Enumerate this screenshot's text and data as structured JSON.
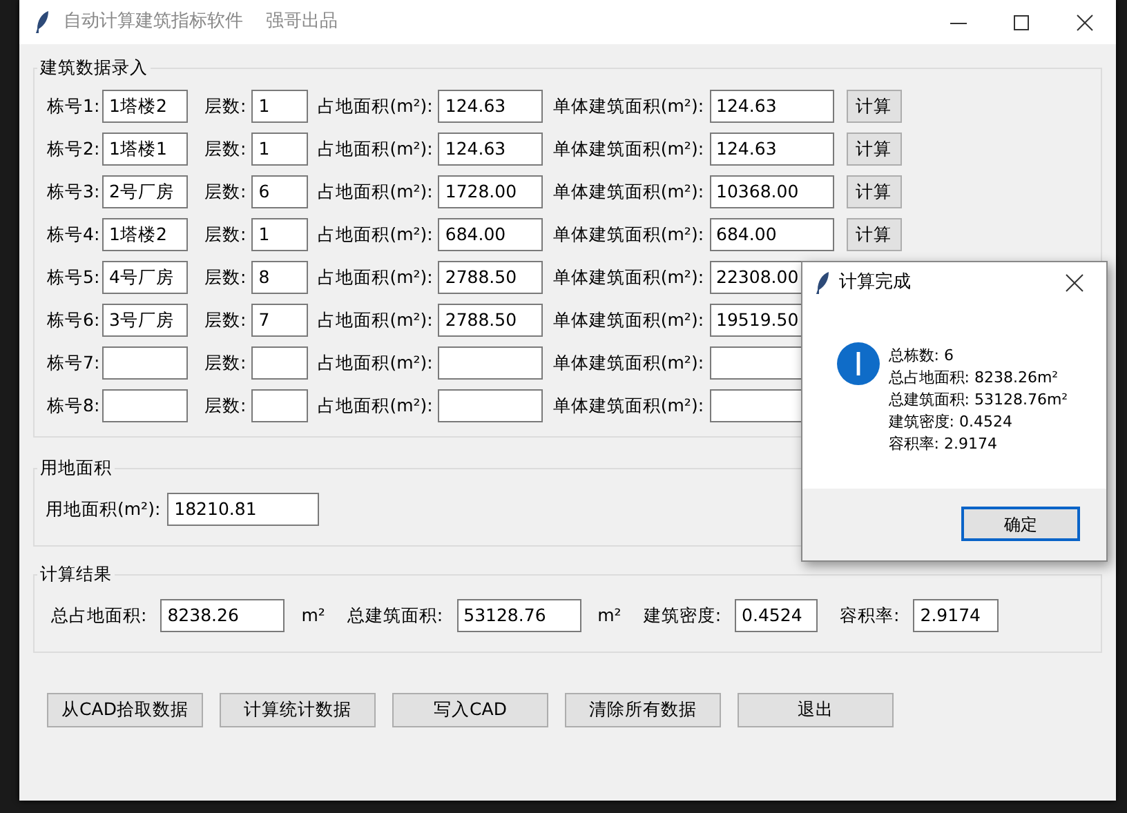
{
  "window": {
    "title": "自动计算建筑指标软件    强哥出品"
  },
  "entry_group": {
    "title": "建筑数据录入",
    "rows": [
      {
        "id_label": "栋号1:",
        "id_value": "1塔楼2",
        "floors_label": "层数:",
        "floors": "1",
        "footprint_label": "占地面积(m²):",
        "footprint": "124.63",
        "area_label": "单体建筑面积(m²):",
        "area": "124.63",
        "button": "计算"
      },
      {
        "id_label": "栋号2:",
        "id_value": "1塔楼1",
        "floors_label": "层数:",
        "floors": "1",
        "footprint_label": "占地面积(m²):",
        "footprint": "124.63",
        "area_label": "单体建筑面积(m²):",
        "area": "124.63",
        "button": "计算"
      },
      {
        "id_label": "栋号3:",
        "id_value": "2号厂房",
        "floors_label": "层数:",
        "floors": "6",
        "footprint_label": "占地面积(m²):",
        "footprint": "1728.00",
        "area_label": "单体建筑面积(m²):",
        "area": "10368.00",
        "button": "计算"
      },
      {
        "id_label": "栋号4:",
        "id_value": "1塔楼2",
        "floors_label": "层数:",
        "floors": "1",
        "footprint_label": "占地面积(m²):",
        "footprint": "684.00",
        "area_label": "单体建筑面积(m²):",
        "area": "684.00",
        "button": "计算"
      },
      {
        "id_label": "栋号5:",
        "id_value": "4号厂房",
        "floors_label": "层数:",
        "floors": "8",
        "footprint_label": "占地面积(m²):",
        "footprint": "2788.50",
        "area_label": "单体建筑面积(m²):",
        "area": "22308.00"
      },
      {
        "id_label": "栋号6:",
        "id_value": "3号厂房",
        "floors_label": "层数:",
        "floors": "7",
        "footprint_label": "占地面积(m²):",
        "footprint": "2788.50",
        "area_label": "单体建筑面积(m²):",
        "area": "19519.50"
      },
      {
        "id_label": "栋号7:",
        "floors_label": "层数:",
        "footprint_label": "占地面积(m²):",
        "area_label": "单体建筑面积(m²):"
      },
      {
        "id_label": "栋号8:",
        "floors_label": "层数:",
        "footprint_label": "占地面积(m²):",
        "area_label": "单体建筑面积(m²):"
      }
    ]
  },
  "land_group": {
    "title": "用地面积",
    "label": "用地面积(m²):",
    "value": "18210.81"
  },
  "result_group": {
    "title": "计算结果",
    "fields": [
      {
        "label": "总占地面积:",
        "value": "8238.26",
        "unit": "m²"
      },
      {
        "label": "总建筑面积:",
        "value": "53128.76",
        "unit": "m²"
      },
      {
        "label": "建筑密度:",
        "value": "0.4524"
      },
      {
        "label": "容积率:",
        "value": "2.9174"
      }
    ]
  },
  "buttons": [
    "从CAD拾取数据",
    "计算统计数据",
    "写入CAD",
    "清除所有数据",
    "退出"
  ],
  "dialog": {
    "title": "计算完成",
    "lines": [
      "总栋数: 6",
      "总占地面积: 8238.26m²",
      "总建筑面积: 53128.76m²",
      "建筑密度: 0.4524",
      "容积率: 2.9174"
    ],
    "button": "确定"
  }
}
